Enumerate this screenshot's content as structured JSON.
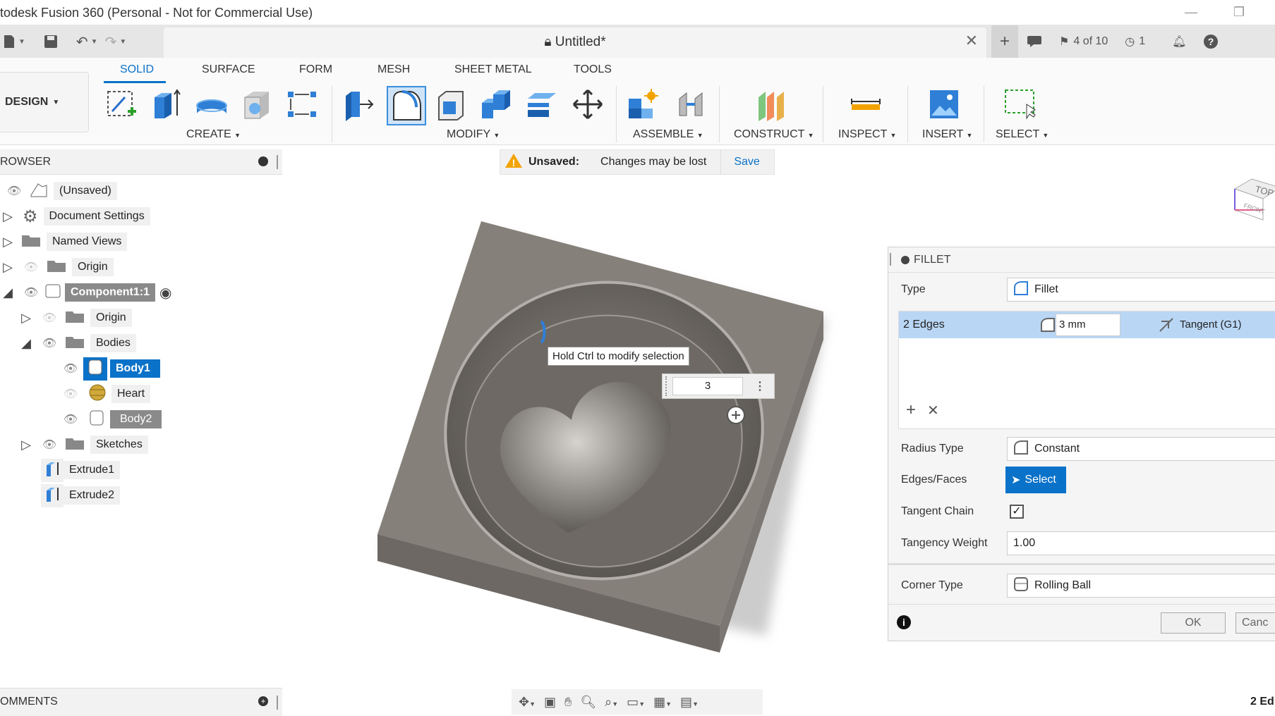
{
  "app": {
    "title": "todesk Fusion 360 (Personal - Not for Commercial Use)"
  },
  "tabbar": {
    "doc_title": "Untitled*",
    "jobs": "4 of 10",
    "clock_count": "1"
  },
  "toolbar": {
    "tabs": [
      "SOLID",
      "SURFACE",
      "FORM",
      "MESH",
      "SHEET METAL",
      "TOOLS"
    ],
    "active_tab": "SOLID",
    "workspace": "DESIGN",
    "groups": [
      "CREATE",
      "MODIFY",
      "ASSEMBLE",
      "CONSTRUCT",
      "INSPECT",
      "INSERT",
      "SELECT"
    ]
  },
  "banner": {
    "label": "Unsaved:",
    "message": "Changes may be lost",
    "action": "Save"
  },
  "browser": {
    "title": "ROWSER",
    "items": [
      {
        "label": "(Unsaved)"
      },
      {
        "label": "Document Settings"
      },
      {
        "label": "Named Views"
      },
      {
        "label": "Origin"
      },
      {
        "label": "Component1:1"
      },
      {
        "label": "Origin"
      },
      {
        "label": "Bodies"
      },
      {
        "label": "Body1"
      },
      {
        "label": "Heart"
      },
      {
        "label": "Body2"
      },
      {
        "label": "Sketches"
      },
      {
        "label": "Extrude1"
      },
      {
        "label": "Extrude2"
      }
    ]
  },
  "viewport": {
    "tooltip": "Hold Ctrl to modify selection",
    "radius_input": "3",
    "viewcube_top": "TOP",
    "viewcube_front": "FRONT"
  },
  "fillet": {
    "title": "FILLET",
    "type_label": "Type",
    "type_value": "Fillet",
    "edges_label": "2 Edges",
    "edges_radius": "3 mm",
    "edges_continuity": "Tangent (G1)",
    "radius_type_label": "Radius Type",
    "radius_type_value": "Constant",
    "edges_faces_label": "Edges/Faces",
    "select_btn": "Select",
    "tangent_chain_label": "Tangent Chain",
    "tangency_weight_label": "Tangency Weight",
    "tangency_weight_value": "1.00",
    "corner_type_label": "Corner Type",
    "corner_type_value": "Rolling Ball",
    "ok": "OK",
    "cancel": "Canc"
  },
  "comments": {
    "title": "OMMENTS"
  },
  "status": {
    "text": "2 Ed"
  },
  "colors": {
    "accent": "#0a72c9",
    "selection": "#b9d6f5",
    "body": "#86807a"
  }
}
